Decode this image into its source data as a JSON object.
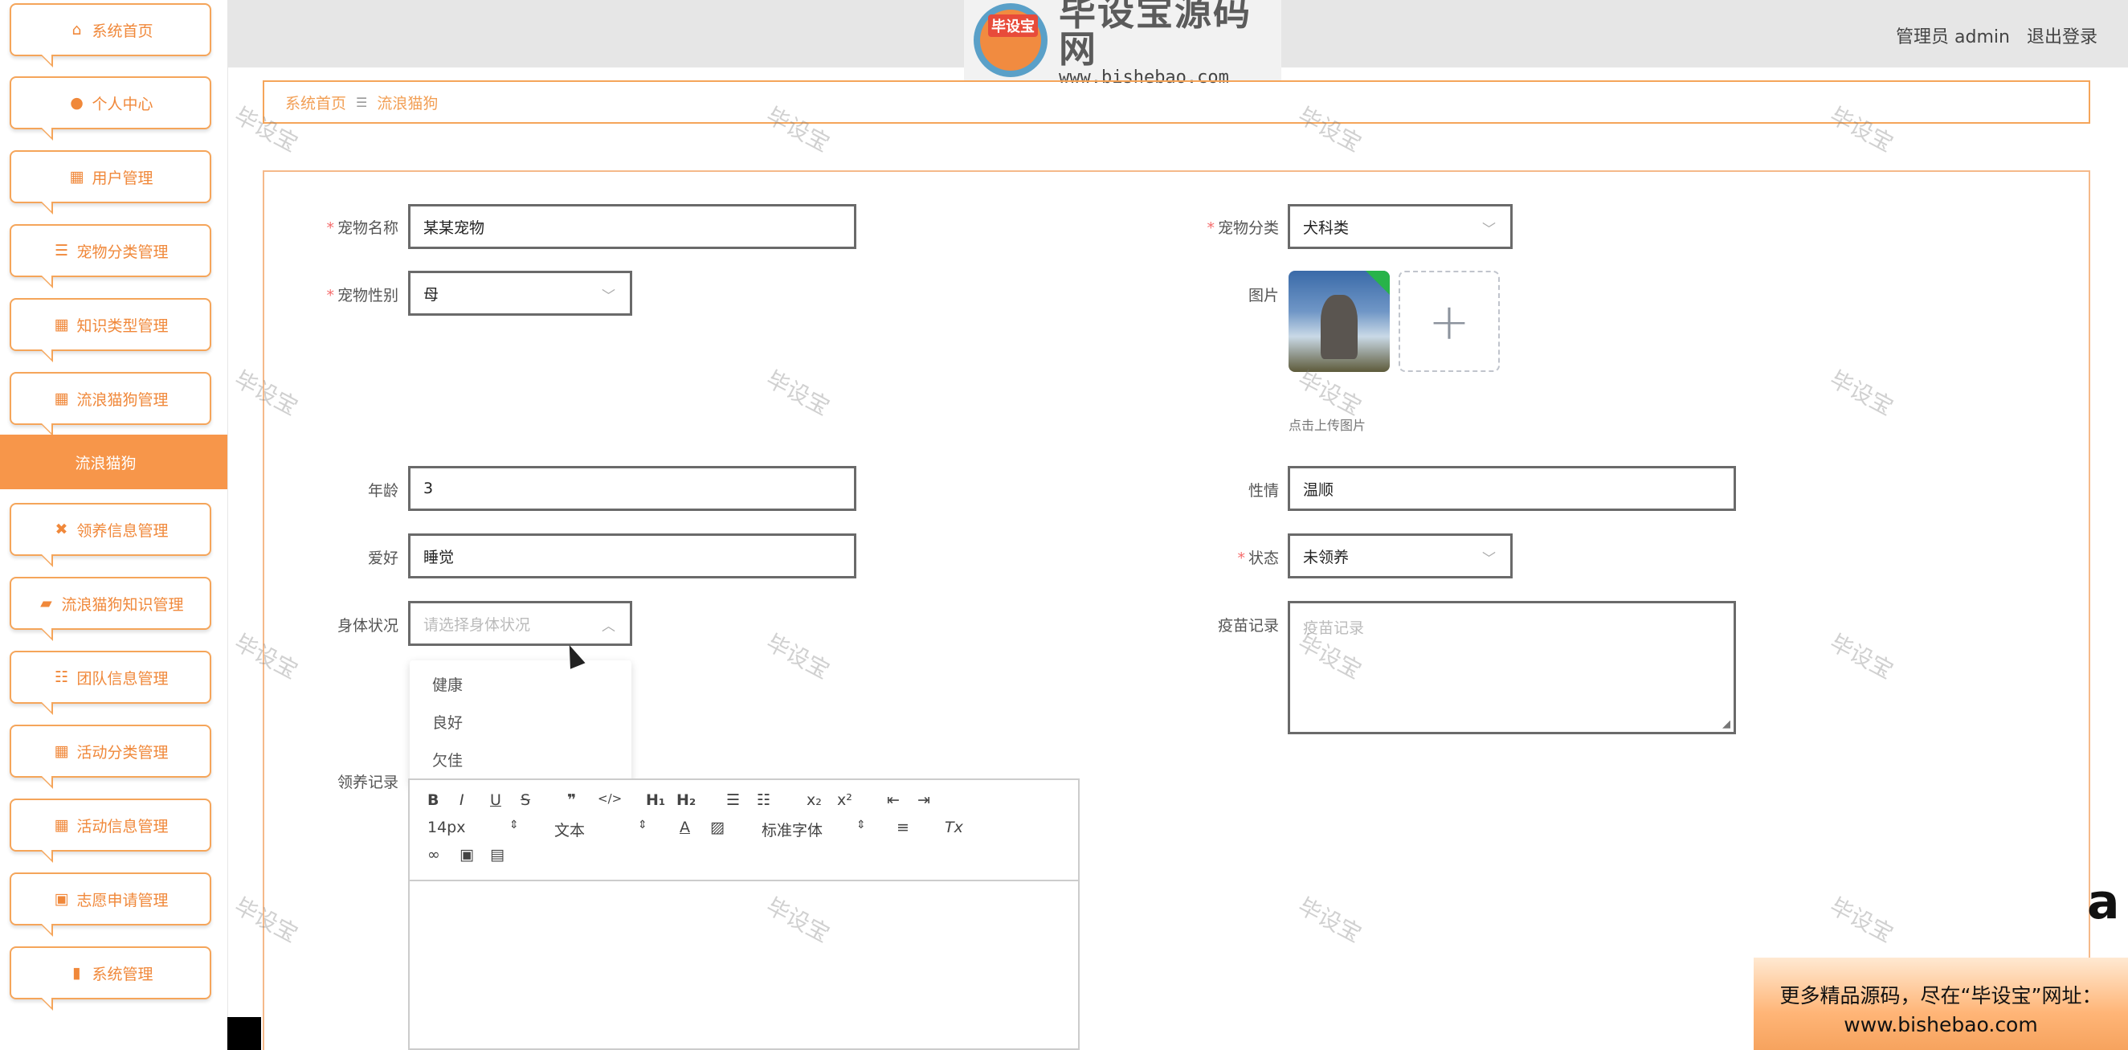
{
  "sidebar": {
    "items": [
      {
        "label": "系统首页",
        "icon": "home-icon",
        "glyph": "⌂"
      },
      {
        "label": "个人中心",
        "icon": "user-icon",
        "glyph": "●"
      },
      {
        "label": "用户管理",
        "icon": "grid-icon",
        "glyph": "▦"
      },
      {
        "label": "宠物分类管理",
        "icon": "list-icon",
        "glyph": "☰"
      },
      {
        "label": "知识类型管理",
        "icon": "grid-icon",
        "glyph": "▦"
      },
      {
        "label": "流浪猫狗管理",
        "icon": "grid-icon",
        "glyph": "▦"
      },
      {
        "label": "领养信息管理",
        "icon": "ticket-icon",
        "glyph": "✖"
      },
      {
        "label": "流浪猫狗知识管理",
        "icon": "briefcase-icon",
        "glyph": "▰"
      },
      {
        "label": "团队信息管理",
        "icon": "sliders-icon",
        "glyph": "☷"
      },
      {
        "label": "活动分类管理",
        "icon": "grid-icon",
        "glyph": "▦"
      },
      {
        "label": "活动信息管理",
        "icon": "grid-icon",
        "glyph": "▦"
      },
      {
        "label": "志愿申请管理",
        "icon": "clipboard-icon",
        "glyph": "▣"
      },
      {
        "label": "系统管理",
        "icon": "bar-chart-icon",
        "glyph": "▮"
      }
    ],
    "active_sub": "流浪猫狗"
  },
  "header": {
    "logo_tag": "毕设宝",
    "logo_title": "毕设宝源码网",
    "logo_url": "www.bishebao.com",
    "user_label": "管理员 admin",
    "logout": "退出登录"
  },
  "breadcrumb": {
    "home": "系统首页",
    "sep": "☰",
    "current": "流浪猫狗"
  },
  "form": {
    "pet_name": {
      "label": "宠物名称",
      "value": "某某宠物"
    },
    "pet_category": {
      "label": "宠物分类",
      "value": "犬科类"
    },
    "pet_gender": {
      "label": "宠物性别",
      "value": "母"
    },
    "picture": {
      "label": "图片",
      "hint": "点击上传图片",
      "plus": "+"
    },
    "age": {
      "label": "年龄",
      "value": "3"
    },
    "temper": {
      "label": "性情",
      "value": "温顺"
    },
    "hobby": {
      "label": "爱好",
      "value": "睡觉"
    },
    "status": {
      "label": "状态",
      "value": "未领养"
    },
    "health": {
      "label": "身体状况",
      "placeholder": "请选择身体状况",
      "options": [
        "健康",
        "良好",
        "欠佳"
      ]
    },
    "vaccine": {
      "label": "疫苗记录",
      "placeholder": "疫苗记录"
    },
    "adoption": {
      "label": "领养记录"
    }
  },
  "editor": {
    "font_size": "14px",
    "block_type": "文本",
    "font_family": "标准字体"
  },
  "watermark_text": "毕设宝",
  "promo": {
    "line1": "更多精品源码，尽在“毕设宝”网址：",
    "line2": "www.bishebao.com"
  },
  "edge_glyph": "a"
}
